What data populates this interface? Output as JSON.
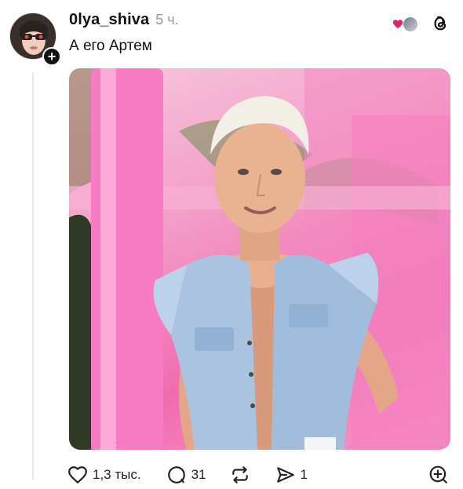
{
  "post": {
    "username": "0lya_shiva",
    "time": "5 ч.",
    "text": "А его Артем"
  },
  "actions": {
    "likes": "1,3 тыс.",
    "replies": "31",
    "shares": "1"
  },
  "colors": {
    "heart": "#e0245e",
    "muted": "#9a9a9a",
    "thread_line": "#e6e6e6"
  },
  "icons": {
    "like": "heart-outline-icon",
    "reply": "comment-icon",
    "repost": "repost-icon",
    "share": "send-icon",
    "more": "plus-circle-icon",
    "app": "threads-logo-icon"
  }
}
